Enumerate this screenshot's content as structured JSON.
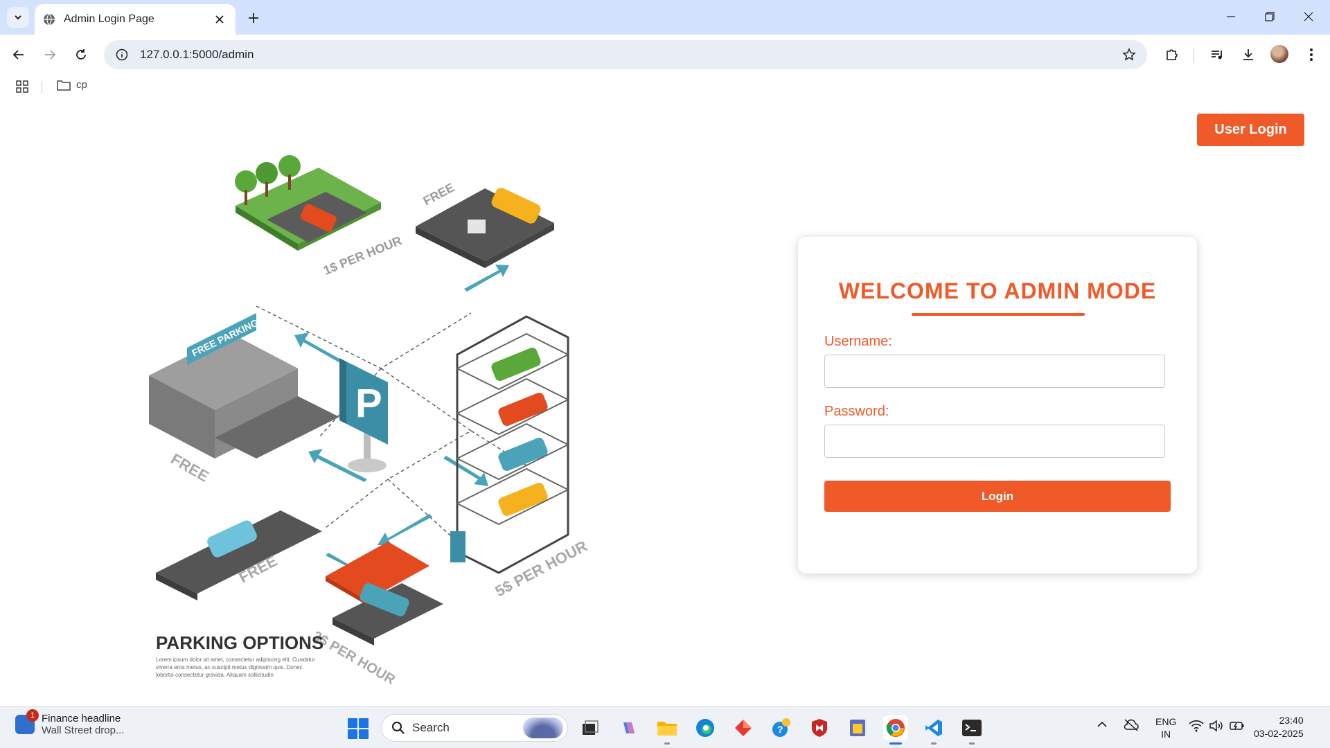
{
  "browser": {
    "tab_title": "Admin Login Page",
    "url": "127.0.0.1:5000/admin",
    "bookmarks": [
      {
        "label": "cp"
      }
    ]
  },
  "page": {
    "user_login_label": "User Login",
    "welcome_title": "WELCOME TO ADMIN MODE",
    "username_label": "Username:",
    "password_label": "Password:",
    "username_value": "",
    "password_value": "",
    "login_label": "Login",
    "accent_color": "#f05a28",
    "illustration": {
      "heading": "PARKING OPTIONS",
      "body": "Lorem ipsum dolor sit amet, consectetur adipiscing elit. Curabitur viverra eros metus, ac suscipit metus dignissim quis. Donec lobortis consectetur gravida. Aliquam sollicitudin",
      "tags": [
        "FREE",
        "1$ PER HOUR",
        "FREE PARKING",
        "FREE",
        "FREE",
        "5$ PER HOUR",
        "3$ PER HOUR"
      ],
      "sign": "P"
    }
  },
  "taskbar": {
    "news_title": "Finance headline",
    "news_subtitle": "Wall Street drop...",
    "news_badge": "1",
    "search_placeholder": "Search",
    "lang_line1": "ENG",
    "lang_line2": "IN",
    "time": "23:40",
    "date": "03-02-2025"
  }
}
